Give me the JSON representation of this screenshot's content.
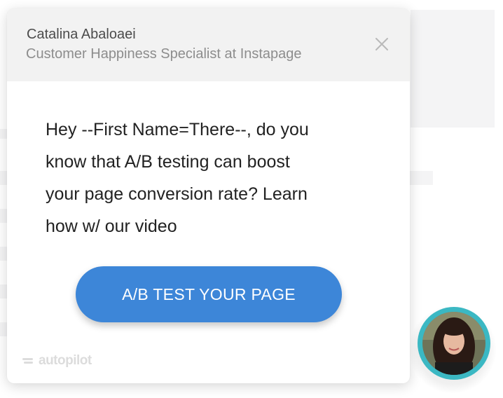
{
  "popup": {
    "sender_name": "Catalina Abaloaei",
    "sender_title": "Customer Happiness Specialist at Instapage",
    "message_lines": [
      "Hey --First Name=There--, do you",
      "know that A/B testing can boost",
      "your page conversion rate? Learn",
      "how w/ our video"
    ],
    "cta_label": "A/B TEST YOUR PAGE",
    "close_icon": "close-icon",
    "branding": "autopilot"
  },
  "avatar": {
    "icon": "avatar",
    "ring_color": "#3bb8c3"
  },
  "colors": {
    "cta": "#3d86d8",
    "header_bg": "#f2f2f2",
    "message_text": "#222222"
  }
}
